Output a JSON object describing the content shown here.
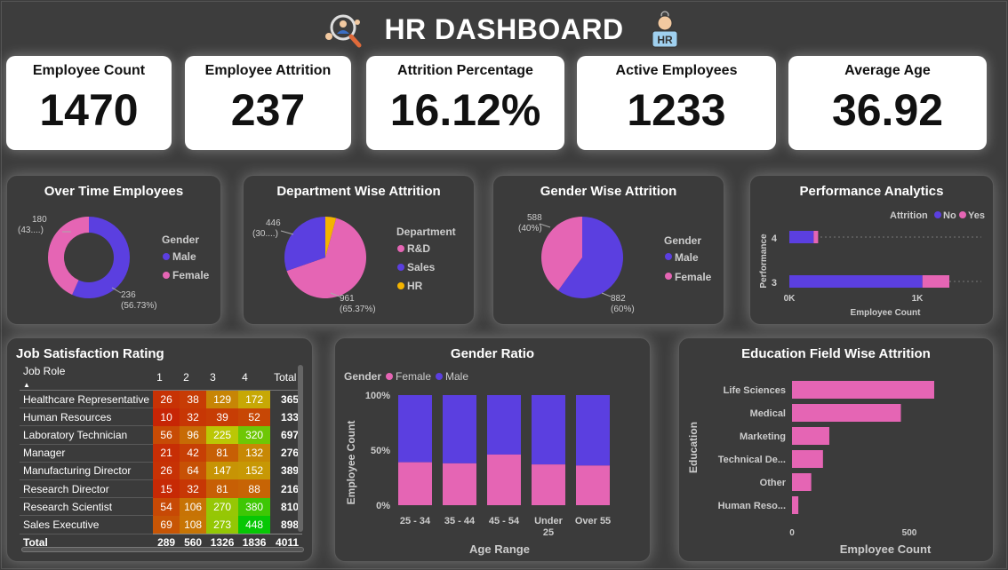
{
  "header": {
    "title": "HR DASHBOARD"
  },
  "kpis": [
    {
      "label": "Employee Count",
      "value": "1470"
    },
    {
      "label": "Employee Attrition",
      "value": "237"
    },
    {
      "label": "Attrition Percentage",
      "value": "16.12%"
    },
    {
      "label": "Active Employees",
      "value": "1233"
    },
    {
      "label": "Average Age",
      "value": "36.92"
    }
  ],
  "colors": {
    "male": "#5b3fe0",
    "female": "#e565b4",
    "hr": "#f4b400"
  },
  "overtime": {
    "title": "Over Time Employees",
    "legend_title": "Gender",
    "legend": [
      "Male",
      "Female"
    ],
    "label_female": [
      "180",
      "(43....)"
    ],
    "label_male": [
      "236",
      "(56.73%)"
    ],
    "chart_data": {
      "type": "pie",
      "categories": [
        "Male",
        "Female"
      ],
      "values": [
        236,
        180
      ]
    }
  },
  "department": {
    "title": "Department Wise Attrition",
    "legend_title": "Department",
    "legend": [
      "R&D",
      "Sales",
      "HR"
    ],
    "label_top": [
      "446",
      "(30....)"
    ],
    "label_bottom": [
      "961",
      "(65.37%)"
    ],
    "chart_data": {
      "type": "pie",
      "categories": [
        "R&D",
        "Sales",
        "HR"
      ],
      "values": [
        961,
        446,
        63
      ]
    }
  },
  "gender": {
    "title": "Gender Wise Attrition",
    "legend_title": "Gender",
    "legend": [
      "Male",
      "Female"
    ],
    "label_female": [
      "588",
      "(40%)"
    ],
    "label_male": [
      "882",
      "(60%)"
    ],
    "chart_data": {
      "type": "pie",
      "categories": [
        "Male",
        "Female"
      ],
      "values": [
        882,
        588
      ]
    }
  },
  "performance": {
    "title": "Performance Analytics",
    "legend_title": "Attrition",
    "legend": [
      "No",
      "Yes"
    ],
    "ylabel": "Performance",
    "xlabel": "Employee Count",
    "xticks": [
      "0K",
      "1K"
    ],
    "chart_data": {
      "type": "bar",
      "orientation": "horizontal",
      "stacked": true,
      "categories": [
        "4",
        "3"
      ],
      "series": [
        {
          "name": "No",
          "values": [
            190,
            1040
          ]
        },
        {
          "name": "Yes",
          "values": [
            35,
            210
          ]
        }
      ],
      "xlim": [
        0,
        1300
      ]
    }
  },
  "jobsat": {
    "title": "Job Satisfaction Rating",
    "headers": [
      "Job Role",
      "1",
      "2",
      "3",
      "4",
      "Total"
    ],
    "rows": [
      {
        "role": "Healthcare Representative",
        "v": [
          "26",
          "38",
          "129",
          "172"
        ],
        "total": "365"
      },
      {
        "role": "Human Resources",
        "v": [
          "10",
          "32",
          "39",
          "52"
        ],
        "total": "133"
      },
      {
        "role": "Laboratory Technician",
        "v": [
          "56",
          "96",
          "225",
          "320"
        ],
        "total": "697"
      },
      {
        "role": "Manager",
        "v": [
          "21",
          "42",
          "81",
          "132"
        ],
        "total": "276"
      },
      {
        "role": "Manufacturing Director",
        "v": [
          "26",
          "64",
          "147",
          "152"
        ],
        "total": "389"
      },
      {
        "role": "Research Director",
        "v": [
          "15",
          "32",
          "81",
          "88"
        ],
        "total": "216"
      },
      {
        "role": "Research Scientist",
        "v": [
          "54",
          "106",
          "270",
          "380"
        ],
        "total": "810"
      },
      {
        "role": "Sales Executive",
        "v": [
          "69",
          "108",
          "273",
          "448"
        ],
        "total": "898"
      }
    ],
    "total_row": {
      "role": "Total",
      "v": [
        "289",
        "560",
        "1326",
        "1836"
      ],
      "total": "4011"
    }
  },
  "gender_ratio": {
    "title": "Gender Ratio",
    "legend_title": "Gender",
    "legend": [
      "Female",
      "Male"
    ],
    "ylabel": "Employee Count",
    "xlabel": "Age Range",
    "yticks": [
      "100%",
      "50%",
      "0%"
    ],
    "chart_data": {
      "type": "bar",
      "stacked": true,
      "percent": true,
      "categories": [
        "25 - 34",
        "35 - 44",
        "45 - 54",
        "Under 25",
        "Over 55"
      ],
      "series": [
        {
          "name": "Female",
          "values": [
            39,
            38,
            46,
            37,
            36
          ]
        },
        {
          "name": "Male",
          "values": [
            61,
            62,
            54,
            63,
            64
          ]
        }
      ],
      "ylim": [
        0,
        100
      ]
    }
  },
  "education": {
    "title": "Education Field Wise Attrition",
    "ylabel": "Education",
    "xlabel": "Employee Count",
    "xticks": [
      "0",
      "500"
    ],
    "chart_data": {
      "type": "bar",
      "orientation": "horizontal",
      "categories": [
        "Life Sciences",
        "Medical",
        "Marketing",
        "Technical De...",
        "Other",
        "Human Reso..."
      ],
      "values": [
        606,
        464,
        159,
        132,
        82,
        27
      ],
      "xlim": [
        0,
        800
      ]
    }
  }
}
